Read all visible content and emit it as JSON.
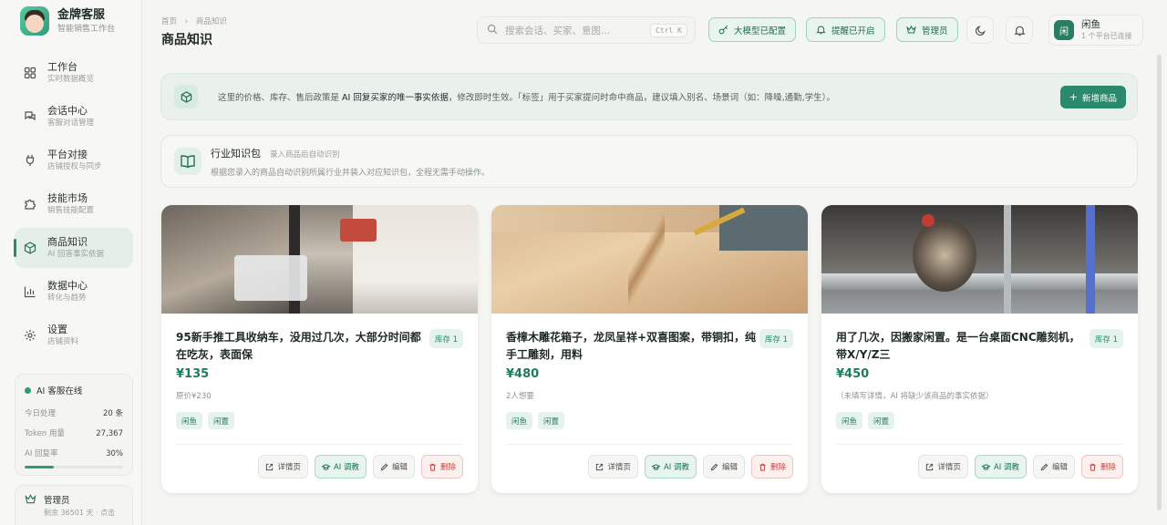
{
  "brand": {
    "name": "金牌客服",
    "subtitle": "智能销售工作台"
  },
  "nav": [
    {
      "label": "工作台",
      "sub": "实时数据概览",
      "icon": "grid-icon"
    },
    {
      "label": "会话中心",
      "sub": "客服对话管理",
      "icon": "chat-icon"
    },
    {
      "label": "平台对接",
      "sub": "店铺授权与同步",
      "icon": "plug-icon"
    },
    {
      "label": "技能市场",
      "sub": "销售技能配置",
      "icon": "puzzle-icon"
    },
    {
      "label": "商品知识",
      "sub": "AI 回答事实依据",
      "icon": "cube-icon",
      "active": true
    },
    {
      "label": "数据中心",
      "sub": "转化与趋势",
      "icon": "chart-icon"
    },
    {
      "label": "设置",
      "sub": "店铺资料",
      "icon": "gear-icon"
    }
  ],
  "ai_status": {
    "title": "AI 客服在线",
    "rows": [
      {
        "k": "今日处理",
        "v": "20 条"
      },
      {
        "k": "Token 用量",
        "v": "27,367"
      },
      {
        "k": "AI 回复率",
        "v": "30%"
      }
    ],
    "reply_rate": 0.3
  },
  "admin": {
    "name": "管理员",
    "sub": "剩余 36501 天 · 点击"
  },
  "breadcrumb": {
    "home": "首页",
    "sep": "›",
    "current": "商品知识"
  },
  "page_title": "商品知识",
  "search": {
    "placeholder": "搜索会话、买家、意图...",
    "shortcut": "Ctrl K"
  },
  "pills": {
    "model": "大模型已配置",
    "reminder": "提醒已开启",
    "admin": "管理员"
  },
  "user": {
    "avatar": "闲",
    "name": "闲鱼",
    "sub": "1 个平台已连接"
  },
  "banner": {
    "text_a": "这里的价格、库存、售后政策是 ",
    "text_b": "AI 回复买家的唯一事实依据",
    "text_c": "，修改即时生效。「标签」用于买家提问时命中商品，建议填入别名、场景词（如：降噪,通勤,学生）。",
    "add_button": "新增商品"
  },
  "knowledge_pack": {
    "title": "行业知识包",
    "hint": "录入商品后自动识别",
    "desc": "根据您录入的商品自动识别所属行业并装入对应知识包，全程无需手动操作。"
  },
  "products": [
    {
      "title": "95新手推工具收纳车，没用过几次，大部分时间都在吃灰，表面保",
      "stock": "库存 1",
      "price": "¥135",
      "meta": "原价¥230",
      "tags": [
        "闲鱼",
        "闲置"
      ]
    },
    {
      "title": "香樟木雕花箱子，龙凤呈祥+双喜图案，带铜扣，纯手工雕刻，用料",
      "stock": "库存 1",
      "price": "¥480",
      "meta": "2人想要",
      "tags": [
        "闲鱼",
        "闲置"
      ]
    },
    {
      "title": "用了几次，因搬家闲置。是一台桌面CNC雕刻机，带X/Y/Z三",
      "stock": "库存 1",
      "price": "¥450",
      "meta": "（未填写详情，AI 将缺少该商品的事实依据）",
      "tags": [
        "闲鱼",
        "闲置"
      ]
    }
  ],
  "actions": {
    "detail": "详情页",
    "ai": "AI 调教",
    "edit": "编辑",
    "delete": "删除"
  },
  "colors": {
    "accent": "#2a8a6b",
    "danger": "#c0473d"
  }
}
